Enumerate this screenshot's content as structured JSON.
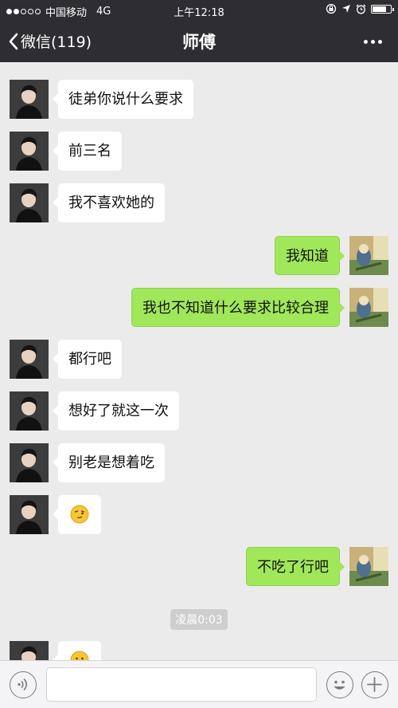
{
  "status_bar": {
    "carrier": "中国移动",
    "network": "4G",
    "time": "上午12:18",
    "battery_level": 0.8
  },
  "nav": {
    "back_label": "微信(119)",
    "title": "师傅"
  },
  "messages": [
    {
      "side": "in",
      "text": "徒弟你说什么要求"
    },
    {
      "side": "in",
      "text": "前三名"
    },
    {
      "side": "in",
      "text": "我不喜欢她的"
    },
    {
      "side": "out",
      "text": "我知道"
    },
    {
      "side": "out",
      "text": "我也不知道什么要求比较合理"
    },
    {
      "side": "in",
      "text": "都行吧"
    },
    {
      "side": "in",
      "text": "想好了就这一次"
    },
    {
      "side": "in",
      "text": "别老是想着吃"
    },
    {
      "side": "in",
      "text": "",
      "emoji": "squint-face"
    },
    {
      "side": "out",
      "text": "不吃了行吧"
    },
    {
      "side": "in",
      "text": "",
      "emoji": "face"
    }
  ],
  "timestamp": "凌晨0:03",
  "input": {
    "value": "",
    "placeholder": ""
  },
  "icons": {
    "voice": "voice-icon",
    "emoji": "emoji-icon",
    "add": "plus-icon"
  },
  "colors": {
    "bar": "#2e2e32",
    "sent_bubble": "#a0e75a",
    "received_bubble": "#ffffff",
    "background": "#ebebeb"
  }
}
